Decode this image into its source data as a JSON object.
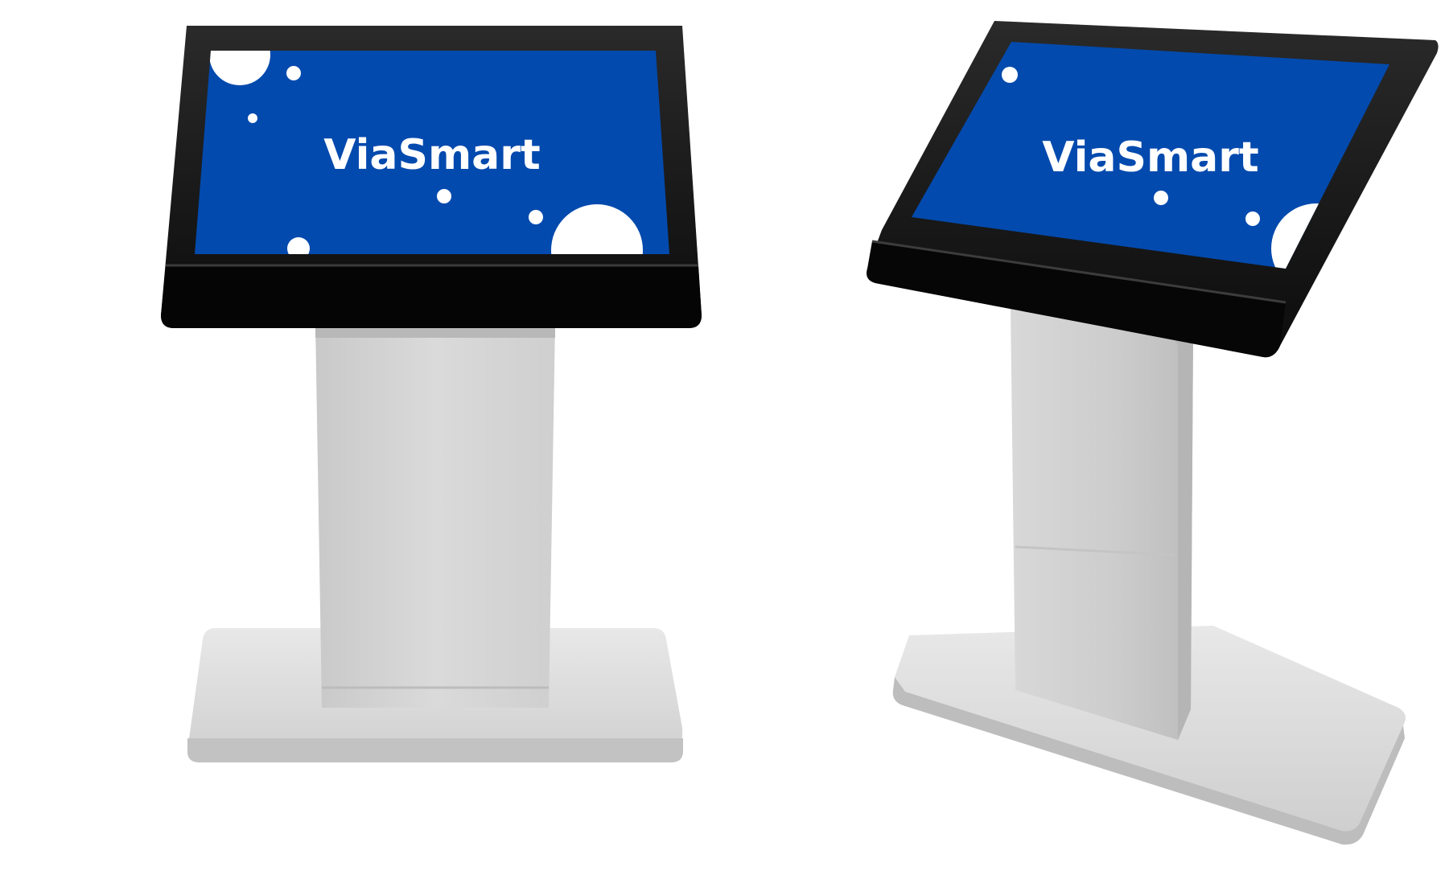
{
  "kiosks": [
    {
      "id": "front",
      "screen_text": "ViaSmart"
    },
    {
      "id": "angled",
      "screen_text": "ViaSmart"
    }
  ],
  "colors": {
    "background": "#ffffff",
    "screen_blue": "#034aae",
    "bezel": "#141414",
    "stand": "#d6d6d6",
    "base": "#e4e4e4",
    "dot": "#ffffff"
  }
}
